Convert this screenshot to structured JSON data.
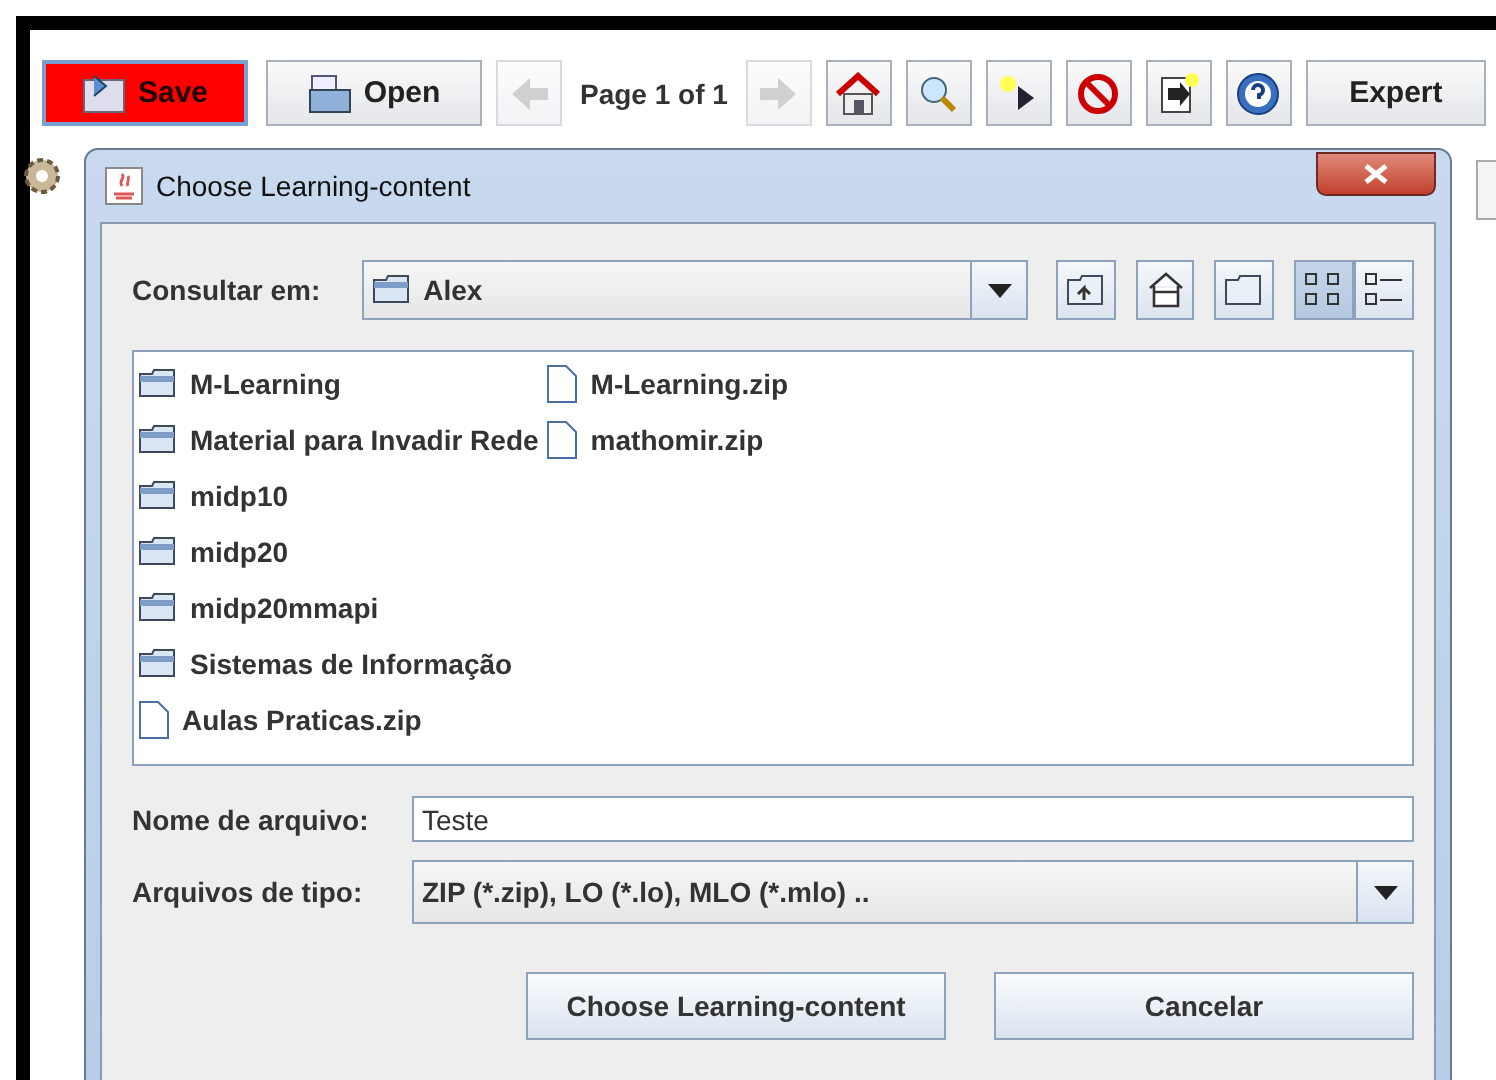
{
  "toolbar": {
    "save": "Save",
    "open": "Open",
    "back": {
      "disabled": true
    },
    "page_label": "Page 1 of 1",
    "forward": {
      "disabled": true
    },
    "expert": "Expert"
  },
  "dialog": {
    "title": "Choose Learning-content",
    "look_in": {
      "label": "Consultar em:",
      "value": "Alex"
    },
    "view_buttons": [
      {
        "kind": "list",
        "selected": true
      },
      {
        "kind": "details",
        "selected": false
      }
    ],
    "files": [
      {
        "kind": "folder",
        "name": "M-Learning"
      },
      {
        "kind": "folder",
        "name": "Material para Invadir Rede"
      },
      {
        "kind": "folder",
        "name": "midp10"
      },
      {
        "kind": "folder",
        "name": "midp20"
      },
      {
        "kind": "folder",
        "name": "midp20mmapi"
      },
      {
        "kind": "folder",
        "name": "Sistemas de Informação"
      },
      {
        "kind": "file",
        "name": "Aulas Praticas.zip"
      },
      {
        "kind": "file",
        "name": "M-Learning.zip"
      },
      {
        "kind": "file",
        "name": "mathomir.zip"
      }
    ],
    "file_name": {
      "label": "Nome de arquivo:",
      "value": "Teste"
    },
    "file_type": {
      "label": "Arquivos de tipo:",
      "value": "ZIP (*.zip), LO (*.lo), MLO (*.mlo) .."
    },
    "buttons": [
      "Choose Learning-content",
      "Cancelar"
    ]
  }
}
